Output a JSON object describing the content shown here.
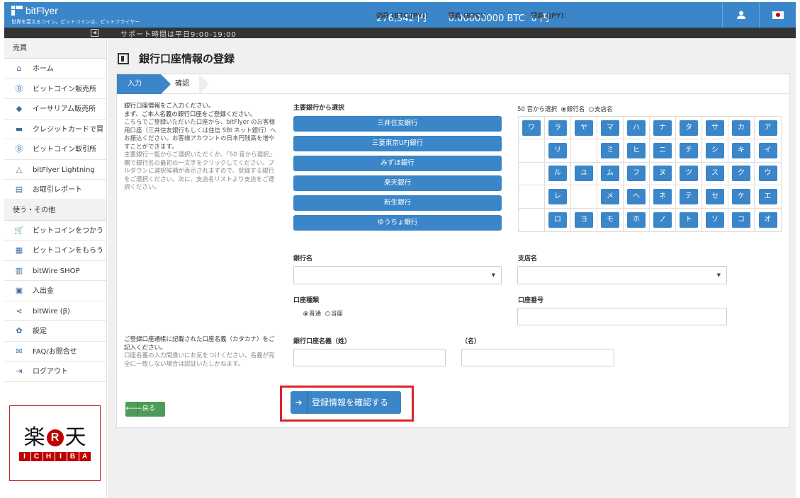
{
  "header": {
    "logo": "bitFlyer",
    "tagline": "世界を変えるコイン。ビットコインは、ビットフライヤー",
    "price_label": "価格 (BTC/JPY)：",
    "price_value": "276,542 円",
    "btc_label": "残高 (BTC)：",
    "btc_value": "0.00000000 BTC",
    "jpy_label": "残高 (JPY)：",
    "jpy_value": "0 円",
    "user_icon": "user-icon",
    "flag_icon": "japan-flag-icon"
  },
  "support_bar": {
    "text": "サポート時間は平日9:00-19:00"
  },
  "sidebar": {
    "section1": "売買",
    "items1": [
      {
        "label": "ホーム",
        "icon": "home-icon",
        "glyph": "⌂"
      },
      {
        "label": "ビットコイン販売所",
        "icon": "bitcoin-icon",
        "glyph": "Ⓑ"
      },
      {
        "label": "イーサリアム販売所",
        "icon": "ethereum-icon",
        "glyph": "◆"
      },
      {
        "label": "クレジットカードで買",
        "icon": "credit-card-icon",
        "glyph": "▬"
      },
      {
        "label": "ビットコイン取引所",
        "icon": "bitcoin-exchange-icon",
        "glyph": "Ⓑ"
      },
      {
        "label": "bitFlyer Lightning",
        "icon": "lightning-icon",
        "glyph": "△"
      },
      {
        "label": "お取引レポート",
        "icon": "report-icon",
        "glyph": "▤"
      }
    ],
    "section2": "使う・その他",
    "items2": [
      {
        "label": "ビットコインをつかう",
        "icon": "cart-icon",
        "glyph": "🛒"
      },
      {
        "label": "ビットコインをもらう",
        "icon": "gift-icon",
        "glyph": "▦"
      },
      {
        "label": "bitWire SHOP",
        "icon": "shop-icon",
        "glyph": "▥"
      },
      {
        "label": "入出金",
        "icon": "deposit-icon",
        "glyph": "▣"
      },
      {
        "label": "bitWire (β)",
        "icon": "share-icon",
        "glyph": "⋖"
      },
      {
        "label": "設定",
        "icon": "gear-icon",
        "glyph": "✿"
      },
      {
        "label": "FAQ/お問合せ",
        "icon": "mail-icon",
        "glyph": "✉"
      },
      {
        "label": "ログアウト",
        "icon": "logout-icon",
        "glyph": "⇥"
      }
    ],
    "ad": {
      "top_left": "楽",
      "mark": "R",
      "top_right": "天",
      "bottom": [
        "I",
        "C",
        "H",
        "I",
        "B",
        "A"
      ]
    }
  },
  "main": {
    "title": "銀行口座情報の登録",
    "steps": [
      "入力",
      "確認"
    ],
    "description": {
      "bold": "銀行口座情報をご入力ください。\nまず、ご本人名義の銀行口座をご登録ください。",
      "body": "こちらでご登録いただいた口座から、bitFlyer のお客様用口座（三井住友銀行もしくは住信 SBI ネット銀行）へお振込ください。お客様アカウントの日本円残高を増やすことができます。",
      "hint": "主要銀行一覧からご選択いただくか、「50 音から選択」欄で銀行名の最初の一文字をクリックしてください。プルダウンに選択候補が表示されますので、登録する銀行をご選択ください。次に、支店名リストより支店をご選択ください。"
    },
    "major_banks_label": "主要銀行から選択",
    "major_banks": [
      "三井住友銀行",
      "三菱東京UFJ銀行",
      "みずほ銀行",
      "楽天銀行",
      "新生銀行",
      "ゆうちょ銀行"
    ],
    "kana_label": "50 音から選択",
    "kana_option_bank": "銀行名",
    "kana_option_branch": "支店名",
    "kana_rows": [
      [
        "ワ",
        "ラ",
        "ヤ",
        "マ",
        "ハ",
        "ナ",
        "タ",
        "サ",
        "カ",
        "ア"
      ],
      [
        "",
        "リ",
        "",
        "ミ",
        "ヒ",
        "ニ",
        "チ",
        "シ",
        "キ",
        "イ"
      ],
      [
        "",
        "ル",
        "ユ",
        "ム",
        "フ",
        "ヌ",
        "ツ",
        "ス",
        "ク",
        "ウ"
      ],
      [
        "",
        "レ",
        "",
        "メ",
        "ヘ",
        "ネ",
        "テ",
        "セ",
        "ケ",
        "エ"
      ],
      [
        "",
        "ロ",
        "ヨ",
        "モ",
        "ホ",
        "ノ",
        "ト",
        "ソ",
        "コ",
        "オ"
      ]
    ],
    "bank_name_label": "銀行名",
    "branch_name_label": "支店名",
    "account_type_label": "口座種類",
    "account_type_options": [
      "普通",
      "当座"
    ],
    "account_number_label": "口座番号",
    "holder_desc_bold": "ご登録口座通帳に記載された口座名義（カタカナ）をご記入ください。",
    "holder_desc_note": "口座名義の入力間違いにお気をつけください。名義が完全に一致しない場合は認証いたしかねます。",
    "holder_last_label": "銀行口座名義（姓）",
    "holder_first_label": "（名）",
    "back_label": "戻る",
    "confirm_label": "登録情報を確認する"
  },
  "colors": {
    "primary": "#3a86c8",
    "back_button": "#4e9a59",
    "highlight": "#e0222a",
    "rakuten": "#bf0000"
  }
}
